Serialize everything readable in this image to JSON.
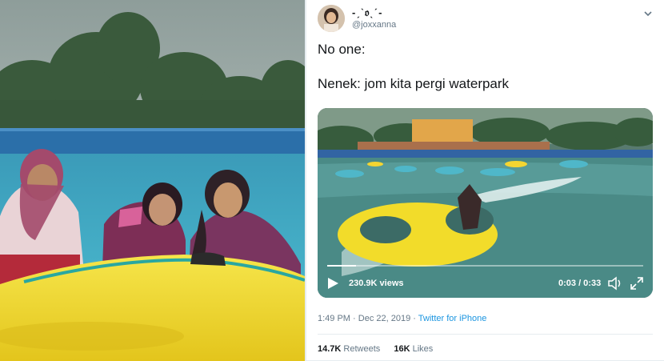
{
  "tweet": {
    "display_name": "-ˏˋ𝔬ˎˊ-",
    "handle": "@joxxanna",
    "line1": "No one:",
    "line2": "Nenek: jom kita pergi waterpark",
    "video": {
      "views": "230.9K views",
      "timecode": "0:03 / 0:33",
      "progress": 0.09,
      "sign_text": ""
    },
    "time": "1:49 PM",
    "date": "Dec 22, 2019",
    "dot": "·",
    "source": "Twitter for iPhone",
    "retweets_count": "14.7K",
    "retweets_label": "Retweets",
    "likes_count": "16K",
    "likes_label": "Likes"
  },
  "colors": {
    "link": "#1b95e0",
    "secondary_text": "#657786",
    "primary_text": "#14171a",
    "raft_yellow": "#f2dc2a",
    "hijab_pink": "#b44a78"
  },
  "icons": {
    "chevron": "chevron-down-icon",
    "play": "play-icon",
    "volume": "volume-icon",
    "fullscreen": "fullscreen-icon"
  }
}
